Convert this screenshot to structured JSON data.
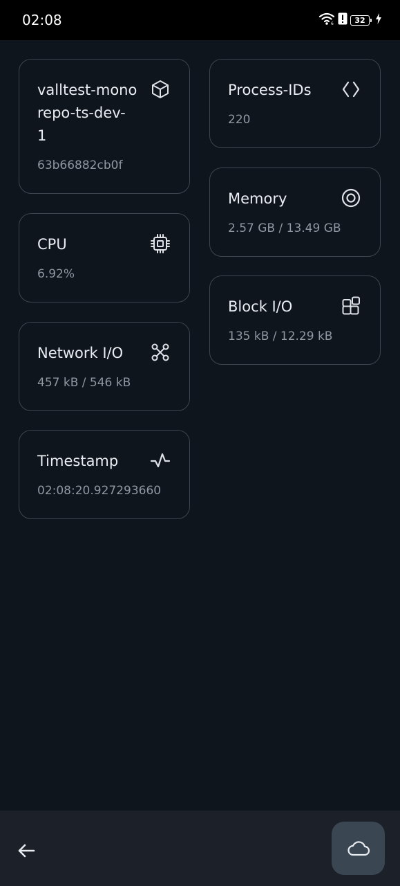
{
  "status_bar": {
    "time": "02:08",
    "battery_level": "32",
    "icons": [
      "wifi-icon",
      "alert-icon",
      "battery-icon",
      "charging-icon"
    ]
  },
  "cards": {
    "container": {
      "title_line1": "valltest-mono",
      "title_line2": "repo-ts-dev-",
      "title_line3": "1",
      "value": "63b66882cb0f",
      "icon": "cube-icon"
    },
    "process_ids": {
      "title": "Process-IDs",
      "value": "220",
      "icon": "code-brackets-icon"
    },
    "memory": {
      "title": "Memory",
      "value": "2.57 GB / 13.49 GB",
      "icon": "target-icon"
    },
    "cpu": {
      "title": "CPU",
      "value": "6.92%",
      "icon": "cpu-chip-icon"
    },
    "block_io": {
      "title": "Block I/O",
      "value": "135 kB / 12.29 kB",
      "icon": "blocks-icon"
    },
    "network_io": {
      "title": "Network I/O",
      "value": "457 kB / 546 kB",
      "icon": "network-nodes-icon"
    },
    "timestamp": {
      "title": "Timestamp",
      "value": "02:08:20.927293660",
      "icon": "pulse-icon"
    }
  },
  "bottom_bar": {
    "back_icon": "arrow-left-icon",
    "fab_icon": "cloud-icon"
  },
  "colors": {
    "background": "#0f151d",
    "card_border": "#3d4550",
    "title_text": "#e9edf2",
    "value_text": "#8f97a1",
    "bottom_bar": "#1b2029",
    "fab": "#3a4753"
  }
}
